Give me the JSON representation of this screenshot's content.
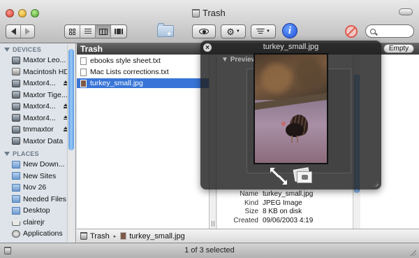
{
  "window": {
    "title": "Trash"
  },
  "toolbar": {
    "back_icon": "back-arrow-icon",
    "forward_icon": "forward-arrow-icon",
    "view_modes": [
      "icon-view",
      "list-view",
      "column-view",
      "coverflow-view"
    ],
    "active_view": "column-view",
    "new_folder_icon": "new-folder-icon",
    "quicklook_icon": "eye-icon",
    "action_icon": "gear-icon",
    "arrange_icon": "arrange-icon",
    "info_icon": "info-icon",
    "info_label": "i",
    "burn_icon": "no-entry-icon",
    "search_icon": "search-icon",
    "search_value": ""
  },
  "sidebar": {
    "devices_label": "DEVICES",
    "devices": [
      {
        "label": "Maxtor Leo...",
        "icon": "external-drive-icon",
        "eject": false
      },
      {
        "label": "Macintosh HD",
        "icon": "hard-drive-icon",
        "eject": false
      },
      {
        "label": "Maxtor4...",
        "icon": "external-drive-icon",
        "eject": true
      },
      {
        "label": "Maxtor Tige...",
        "icon": "external-drive-icon",
        "eject": true
      },
      {
        "label": "Maxtor4...",
        "icon": "external-drive-icon",
        "eject": true
      },
      {
        "label": "Maxtor4...",
        "icon": "external-drive-icon",
        "eject": true
      },
      {
        "label": "tmmaxtor",
        "icon": "external-drive-icon",
        "eject": true
      },
      {
        "label": "Maxtor Data",
        "icon": "external-drive-icon",
        "eject": false
      }
    ],
    "places_label": "PLACES",
    "places": [
      {
        "label": "New Down...",
        "icon": "folder-icon"
      },
      {
        "label": "New Sites",
        "icon": "folder-icon"
      },
      {
        "label": "Nov 26",
        "icon": "folder-icon"
      },
      {
        "label": "Needed Files",
        "icon": "folder-icon"
      },
      {
        "label": "Desktop",
        "icon": "desktop-icon"
      },
      {
        "label": "clairejr",
        "icon": "home-icon"
      },
      {
        "label": "Applications",
        "icon": "applications-icon"
      }
    ]
  },
  "browser": {
    "column_header": "Trash",
    "empty_button": "Empty",
    "files": [
      {
        "name": "ebooks style sheet.txt",
        "selected": false
      },
      {
        "name": "Mac Lists corrections.txt",
        "selected": false
      },
      {
        "name": "turkey_small.jpg",
        "selected": true
      }
    ],
    "preview_info": {
      "name_label": "Name",
      "name_value": "turkey_small.jpg",
      "kind_label": "Kind",
      "kind_value": "JPEG Image",
      "size_label": "Size",
      "size_value": "8 KB on disk",
      "created_label": "Created",
      "created_value": "09/06/2003 4:19"
    }
  },
  "quicklook": {
    "title": "turkey_small.jpg",
    "close_label": "×",
    "ghost_label": "Preview",
    "fullscreen_icon": "fullscreen-arrows-icon",
    "iphoto_icon": "add-to-iphoto-icon"
  },
  "pathbar": {
    "items": [
      "Trash",
      "turkey_small.jpg"
    ],
    "separator": "▸"
  },
  "status": {
    "text": "1 of 3 selected"
  }
}
